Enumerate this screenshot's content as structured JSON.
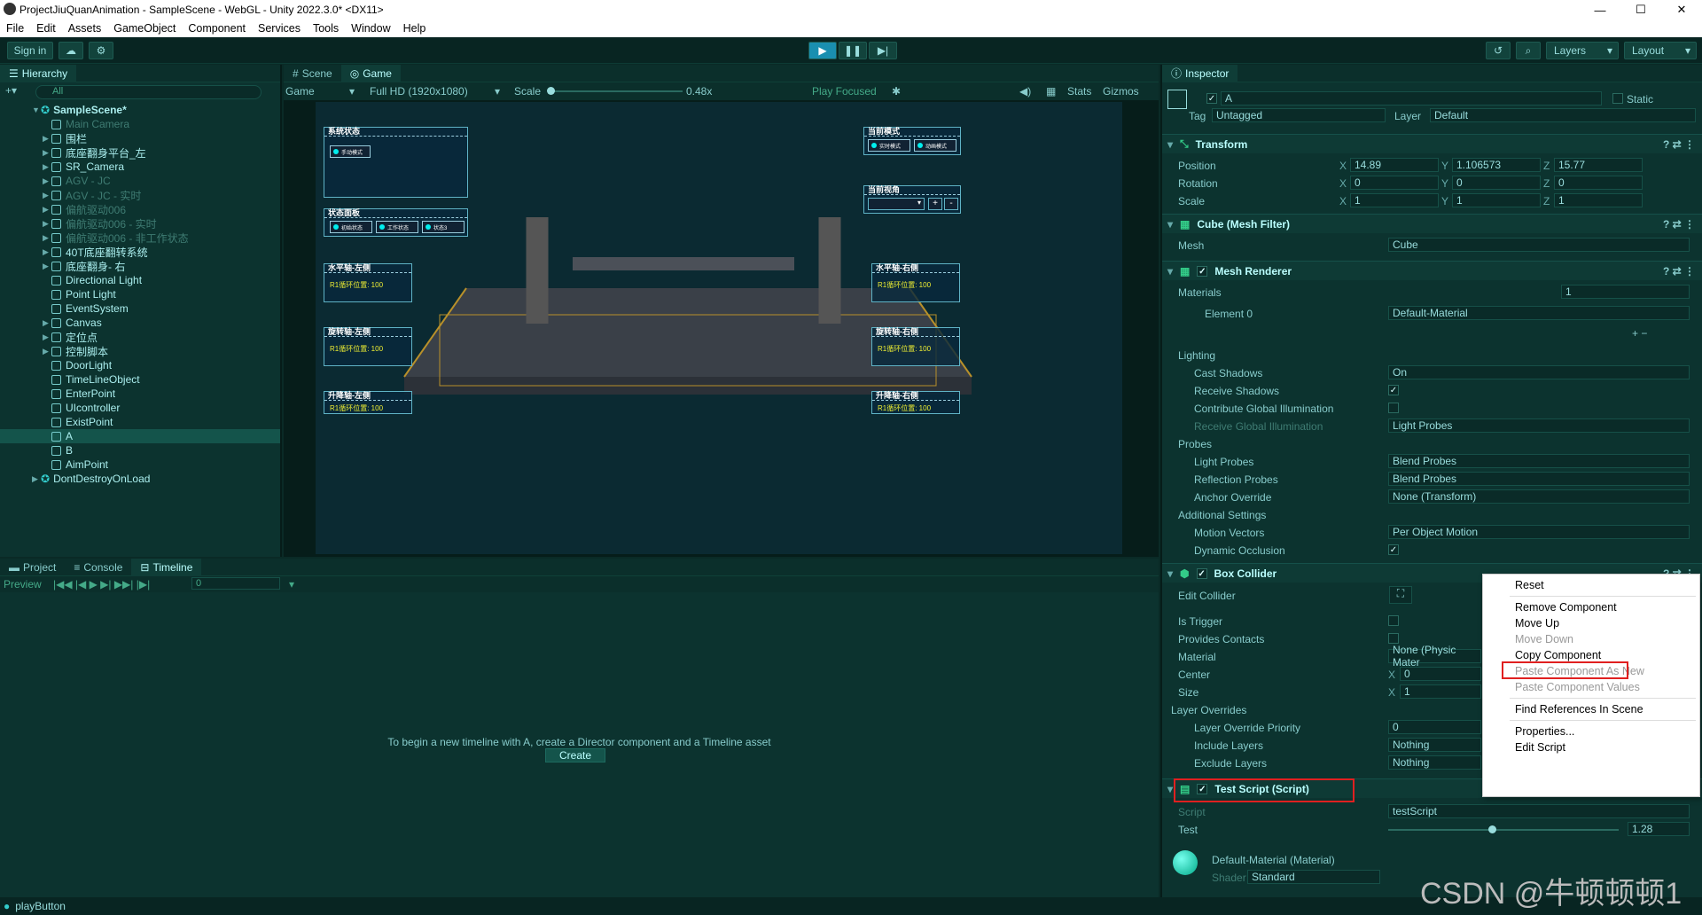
{
  "window": {
    "title": "ProjectJiuQuanAnimation - SampleScene - WebGL - Unity 2022.3.0* <DX11>",
    "minimize": "—",
    "maximize": "☐",
    "close": "✕"
  },
  "menu": [
    "File",
    "Edit",
    "Assets",
    "GameObject",
    "Component",
    "Services",
    "Tools",
    "Window",
    "Help"
  ],
  "toolbar": {
    "sign_in": "Sign in",
    "layers": "Layers",
    "layout": "Layout"
  },
  "hierarchy": {
    "tab": "Hierarchy",
    "search_placeholder": "All",
    "scene": "SampleScene*",
    "dont_destroy": "DontDestroyOnLoad",
    "items": [
      {
        "label": "Main Camera",
        "dim": true,
        "exp": false
      },
      {
        "label": "围栏",
        "dim": false,
        "exp": true
      },
      {
        "label": "底座翻身平台_左",
        "dim": false,
        "exp": true
      },
      {
        "label": "SR_Camera",
        "dim": false,
        "exp": true
      },
      {
        "label": "AGV - JC",
        "dim": true,
        "exp": true
      },
      {
        "label": "AGV - JC - 实时",
        "dim": true,
        "exp": true
      },
      {
        "label": "偏航驱动006",
        "dim": true,
        "exp": true
      },
      {
        "label": "偏航驱动006 - 实时",
        "dim": true,
        "exp": true
      },
      {
        "label": "偏航驱动006 - 非工作状态",
        "dim": true,
        "exp": true
      },
      {
        "label": "40T底座翻转系统",
        "dim": false,
        "exp": true
      },
      {
        "label": "底座翻身- 右",
        "dim": false,
        "exp": true
      },
      {
        "label": "Directional Light",
        "dim": false,
        "exp": false
      },
      {
        "label": "Point Light",
        "dim": false,
        "exp": false
      },
      {
        "label": "EventSystem",
        "dim": false,
        "exp": false
      },
      {
        "label": "Canvas",
        "dim": false,
        "exp": true
      },
      {
        "label": "定位点",
        "dim": false,
        "exp": true
      },
      {
        "label": "控制脚本",
        "dim": false,
        "exp": true
      },
      {
        "label": "DoorLight",
        "dim": false,
        "exp": false
      },
      {
        "label": "TimeLineObject",
        "dim": false,
        "exp": false
      },
      {
        "label": "EnterPoint",
        "dim": false,
        "exp": false
      },
      {
        "label": "UIcontroller",
        "dim": false,
        "exp": false
      },
      {
        "label": "ExistPoint",
        "dim": false,
        "exp": false
      },
      {
        "label": "A",
        "dim": false,
        "exp": false,
        "sel": true
      },
      {
        "label": "B",
        "dim": false,
        "exp": false
      },
      {
        "label": "AimPoint",
        "dim": false,
        "exp": false
      }
    ]
  },
  "game": {
    "tab_scene": "Scene",
    "tab_game": "Game",
    "display": "Game",
    "resolution": "Full HD (1920x1080)",
    "scale_label": "Scale",
    "scale_value": "0.48x",
    "play_focused": "Play Focused",
    "stats": "Stats",
    "gizmos": "Gizmos",
    "hud": {
      "sys_status": "系统状态",
      "sys_btn": "手动模式",
      "panel": "状态面板",
      "panel_btns": [
        "初始状态",
        "工作状态",
        "状态3"
      ],
      "mode": "当前模式",
      "mode_btns": [
        "实时模式",
        "动画模式"
      ],
      "view": "当前视角",
      "hl": "水平轴-左侧",
      "rl": "旋转轴-左侧",
      "ll": "升降轴-左侧",
      "hr": "水平轴-右侧",
      "rr": "旋转轴-右侧",
      "lr": "升降轴-右侧",
      "val": "R1循环位置: 100"
    }
  },
  "bottom": {
    "tabs": [
      "Project",
      "Console",
      "Timeline"
    ],
    "preview": "Preview",
    "frame": "0",
    "message": "To begin a new timeline with A, create a Director component and a Timeline asset",
    "create": "Create"
  },
  "inspector": {
    "tab": "Inspector",
    "name": "A",
    "static": "Static",
    "tag_label": "Tag",
    "tag": "Untagged",
    "layer_label": "Layer",
    "layer": "Default",
    "transform": "Transform",
    "position": "Position",
    "rotation": "Rotation",
    "scale": "Scale",
    "pos": [
      "14.89",
      "1.106573",
      "15.77"
    ],
    "rot": [
      "0",
      "0",
      "0"
    ],
    "scl": [
      "1",
      "1",
      "1"
    ],
    "meshfilter": "Cube (Mesh Filter)",
    "mesh_label": "Mesh",
    "mesh": "Cube",
    "meshrenderer": "Mesh Renderer",
    "materials": "Materials",
    "materials_count": "1",
    "element0": "Element 0",
    "element0_val": "Default-Material",
    "lighting": "Lighting",
    "cast_shadows": "Cast Shadows",
    "cast_shadows_val": "On",
    "receive_shadows": "Receive Shadows",
    "contribute_gi": "Contribute Global Illumination",
    "receive_gi": "Receive Global Illumination",
    "receive_gi_val": "Light Probes",
    "probes": "Probes",
    "light_probes": "Light Probes",
    "light_probes_val": "Blend Probes",
    "reflection_probes": "Reflection Probes",
    "reflection_probes_val": "Blend Probes",
    "anchor": "Anchor Override",
    "anchor_val": "None (Transform)",
    "additional": "Additional Settings",
    "motion_vectors": "Motion Vectors",
    "motion_vectors_val": "Per Object Motion",
    "dynamic_occlusion": "Dynamic Occlusion",
    "boxcollider": "Box Collider",
    "edit_collider": "Edit Collider",
    "is_trigger": "Is Trigger",
    "provides_contacts": "Provides Contacts",
    "material": "Material",
    "material_val": "None (Physic Mater",
    "center": "Center",
    "center_x": "0",
    "size": "Size",
    "size_x": "1",
    "layer_overrides": "Layer Overrides",
    "lo_priority": "Layer Override Priority",
    "lo_priority_val": "0",
    "include_layers": "Include Layers",
    "include_val": "Nothing",
    "exclude_layers": "Exclude Layers",
    "exclude_val": "Nothing",
    "testscript": "Test Script (Script)",
    "script_label": "Script",
    "script_val": "testScript",
    "test_label": "Test",
    "test_val": "1.28",
    "test_fraction": 0.45,
    "material_header": "Default-Material (Material)",
    "shader_label": "Shader",
    "shader_val": "Standard"
  },
  "context_menu": {
    "reset": "Reset",
    "remove": "Remove Component",
    "move_up": "Move Up",
    "move_down": "Move Down",
    "copy": "Copy Component",
    "paste_new": "Paste Component As New",
    "paste_values": "Paste Component Values",
    "find_refs": "Find References In Scene",
    "properties": "Properties...",
    "edit_script": "Edit Script"
  },
  "status": {
    "text": "playButton"
  },
  "watermark": "CSDN @牛顿顿顿1"
}
